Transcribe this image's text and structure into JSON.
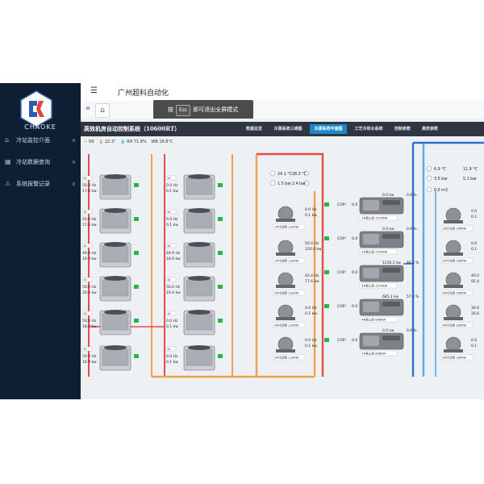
{
  "app": {
    "title": "广州超科自动化"
  },
  "logo": {
    "text": "CHAOKE"
  },
  "sidebar": {
    "items": [
      {
        "icon": "home-icon",
        "label": "冷站监控介面",
        "chevron": "∨"
      },
      {
        "icon": "grid-icon",
        "label": "冷站数据查询",
        "chevron": "∨"
      },
      {
        "icon": "bell-icon",
        "label": "系统报警记录",
        "chevron": "∨"
      }
    ]
  },
  "topbar": {
    "menu_icon": "☰"
  },
  "tabbar": {
    "collapse_icon": "«",
    "home_icon": "⌂"
  },
  "toast": {
    "prefix": "按",
    "key": "Esc",
    "suffix": "即可退出全屏模式"
  },
  "scada": {
    "title": "高效机房自动控制系统（10600RT）",
    "tabs": [
      {
        "label": "数据总览",
        "active": false
      },
      {
        "label": "冷源系统三维图",
        "active": false
      },
      {
        "label": "冷源系统平面图",
        "active": true
      },
      {
        "label": "工艺冷却水系统",
        "active": false
      },
      {
        "label": "控制参数",
        "active": false
      },
      {
        "label": "高效参数",
        "active": false
      }
    ],
    "weather": {
      "code": "09",
      "temp": "22.3",
      "rh_label": "RH",
      "rh": "71.8",
      "wb_label": "WB",
      "wb": "18.8",
      "temp_unit": "°",
      "rh_unit": "%",
      "wb_unit": "°C"
    },
    "towers_left": [
      {
        "id": "10",
        "hz": "50.0 Hz",
        "kw": "17.6 kw"
      },
      {
        "id": "10",
        "hz": "50.0 Hz",
        "kw": "17.6 kw"
      },
      {
        "id": "10",
        "hz": "49.9 Hz",
        "kw": "19.3 kw"
      },
      {
        "id": "10",
        "hz": "50.0 Hz",
        "kw": "20.4 kw"
      },
      {
        "id": "10",
        "hz": "50.0 Hz",
        "kw": "18.2 kw"
      },
      {
        "id": "10",
        "hz": "50.0 Hz",
        "kw": "16.9 kw"
      }
    ],
    "towers_mid": [
      {
        "id": "10",
        "hz": "0.0 Hz",
        "kw": "0.1 kw"
      },
      {
        "id": "10",
        "hz": "0.0 Hz",
        "kw": "0.1 kw"
      },
      {
        "id": "10",
        "hz": "49.9 Hz",
        "kw": "18.6 kw"
      },
      {
        "id": "10",
        "hz": "50.0 Hz",
        "kw": "19.4 kw"
      },
      {
        "id": "10",
        "hz": "0.0 Hz",
        "kw": "0.1 kw"
      },
      {
        "id": "10",
        "hz": "0.0 Hz",
        "kw": "0.1 kw"
      }
    ],
    "cw_temps": {
      "t1": "24.1 °C",
      "t2": "28.3 °C",
      "p1": "1.5 bar",
      "p2": "2.4 bar"
    },
    "chw_temps": {
      "t1": "6.9 °C",
      "t2": "11.9 °C",
      "p1": "3.5 bar",
      "p2": "5.1 bar",
      "flow": "0.0 m3"
    },
    "cw_pumps": [
      {
        "label": "1#冷却泵-132KW",
        "hz": "0.0 Hz",
        "kw": "0.1 kw"
      },
      {
        "label": "2#冷却泵-132KW",
        "hz": "50.0 Hz",
        "kw": "120.0 kw"
      },
      {
        "label": "3#冷却泵-132KW",
        "hz": "43.4 Hz",
        "kw": "77.6 kw"
      },
      {
        "label": "4#冷却泵-132KW",
        "hz": "0.0 Hz",
        "kw": "0.1 kw"
      },
      {
        "label": "5#冷却泵-132KW",
        "hz": "0.0 Hz",
        "kw": "0.1 kw"
      }
    ],
    "chillers": [
      {
        "label": "1#离心机-1525KW",
        "cop_label": "COP:",
        "cop": "0.0",
        "kw": "0.0 kw",
        "pct": "0.0 %"
      },
      {
        "label": "2#离心机-1525KW",
        "cop_label": "COP:",
        "cop": "0.0",
        "kw": "0.0 kw",
        "pct": "0.0 %"
      },
      {
        "label": "3#离心机-1525KW",
        "cop_label": "COP:",
        "cop": "0.0",
        "kw": "1216.2 kw",
        "pct": "86.5 %"
      },
      {
        "label": "4#离心机-638KW",
        "cop_label": "COP:",
        "cop": "0.0",
        "kw": "685.2 kw",
        "pct": "57.3 %"
      },
      {
        "label": "5#离心机-638KW",
        "cop_label": "COP:",
        "cop": "0.0",
        "kw": "0.0 kw",
        "pct": "0.0 %"
      }
    ],
    "chw_pumps": [
      {
        "label": "1#冷冻泵-185KW",
        "hz": "0.0",
        "kw": "0.1"
      },
      {
        "label": "2#冷冻泵-185KW",
        "hz": "0.0",
        "kw": "0.1"
      },
      {
        "label": "3#冷冻泵-185KW",
        "hz": "40.0",
        "kw": "92.4"
      },
      {
        "label": "4#冷冻泵-185KW",
        "hz": "30.0",
        "kw": "26.6"
      },
      {
        "label": "5#冷冻泵-185KW",
        "hz": "0.0",
        "kw": "0.1"
      }
    ],
    "colors": {
      "pipe_cw_supply": "#f0a14a",
      "pipe_cw_return": "#e54b4b",
      "pipe_chw_supply": "#5aa9e6",
      "pipe_chw_return": "#2f6fd1",
      "accent": "#1e88c9"
    }
  }
}
